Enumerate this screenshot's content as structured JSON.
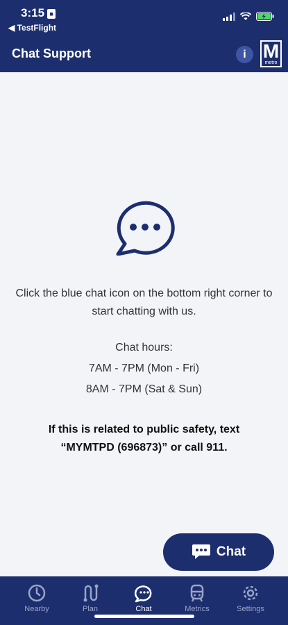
{
  "status_bar": {
    "time": "3:15",
    "back_app": "TestFlight"
  },
  "header": {
    "title": "Chat Support",
    "info_symbol": "i",
    "logo_letter": "M",
    "logo_word": "metro"
  },
  "main": {
    "instruction": "Click the blue chat icon on the bottom right corner to start chatting with us.",
    "hours_label": "Chat hours:",
    "hours": [
      "7AM - 7PM (Mon - Fri)",
      "8AM - 7PM (Sat & Sun)"
    ],
    "safety_notice": "If this is related to public safety, text “MYMTPD (696873)” or call 911."
  },
  "chat_button": {
    "label": "Chat",
    "icon": "chat-bubble-icon"
  },
  "tabs": [
    {
      "label": "Nearby",
      "icon": "clock-icon",
      "active": false
    },
    {
      "label": "Plan",
      "icon": "route-icon",
      "active": false
    },
    {
      "label": "Chat",
      "icon": "chat-icon",
      "active": true
    },
    {
      "label": "Metrics",
      "icon": "train-icon",
      "active": false
    },
    {
      "label": "Settings",
      "icon": "gear-icon",
      "active": false
    }
  ],
  "colors": {
    "brand": "#1c2e6e",
    "background": "#f3f4f8",
    "inactive_tab": "#9aa4c8"
  }
}
